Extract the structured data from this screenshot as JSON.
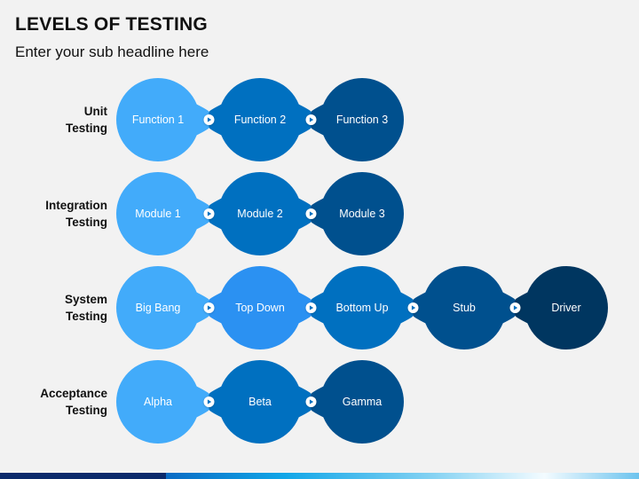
{
  "header": {
    "title": "LEVELS OF TESTING",
    "subtitle": "Enter your sub headline here"
  },
  "colors": {
    "background": "#f2f2f2",
    "light": "#42abfa",
    "bright": "#2b91f2",
    "mid": "#0070c0",
    "dark": "#00508e",
    "darkest": "#003660",
    "connector": "#ffffff",
    "connector_arrow": "#0070c0"
  },
  "rows": [
    {
      "label_line1": "Unit",
      "label_line2": "Testing",
      "nodes": [
        {
          "label": "Function 1",
          "color": "#42abfa"
        },
        {
          "label": "Function 2",
          "color": "#0070c0"
        },
        {
          "label": "Function 3",
          "color": "#00508e"
        }
      ]
    },
    {
      "label_line1": "Integration",
      "label_line2": "Testing",
      "nodes": [
        {
          "label": "Module 1",
          "color": "#42abfa"
        },
        {
          "label": "Module 2",
          "color": "#0070c0"
        },
        {
          "label": "Module 3",
          "color": "#00508e"
        }
      ]
    },
    {
      "label_line1": "System",
      "label_line2": "Testing",
      "nodes": [
        {
          "label": "Big Bang",
          "color": "#42abfa"
        },
        {
          "label": "Top Down",
          "color": "#2b91f2"
        },
        {
          "label": "Bottom Up",
          "color": "#0070c0"
        },
        {
          "label": "Stub",
          "color": "#00508e"
        },
        {
          "label": "Driver",
          "color": "#003660"
        }
      ]
    },
    {
      "label_line1": "Acceptance",
      "label_line2": "Testing",
      "nodes": [
        {
          "label": "Alpha",
          "color": "#42abfa"
        },
        {
          "label": "Beta",
          "color": "#0070c0"
        },
        {
          "label": "Gamma",
          "color": "#00508e"
        }
      ]
    }
  ],
  "connector_icon": "play-arrow-icon"
}
